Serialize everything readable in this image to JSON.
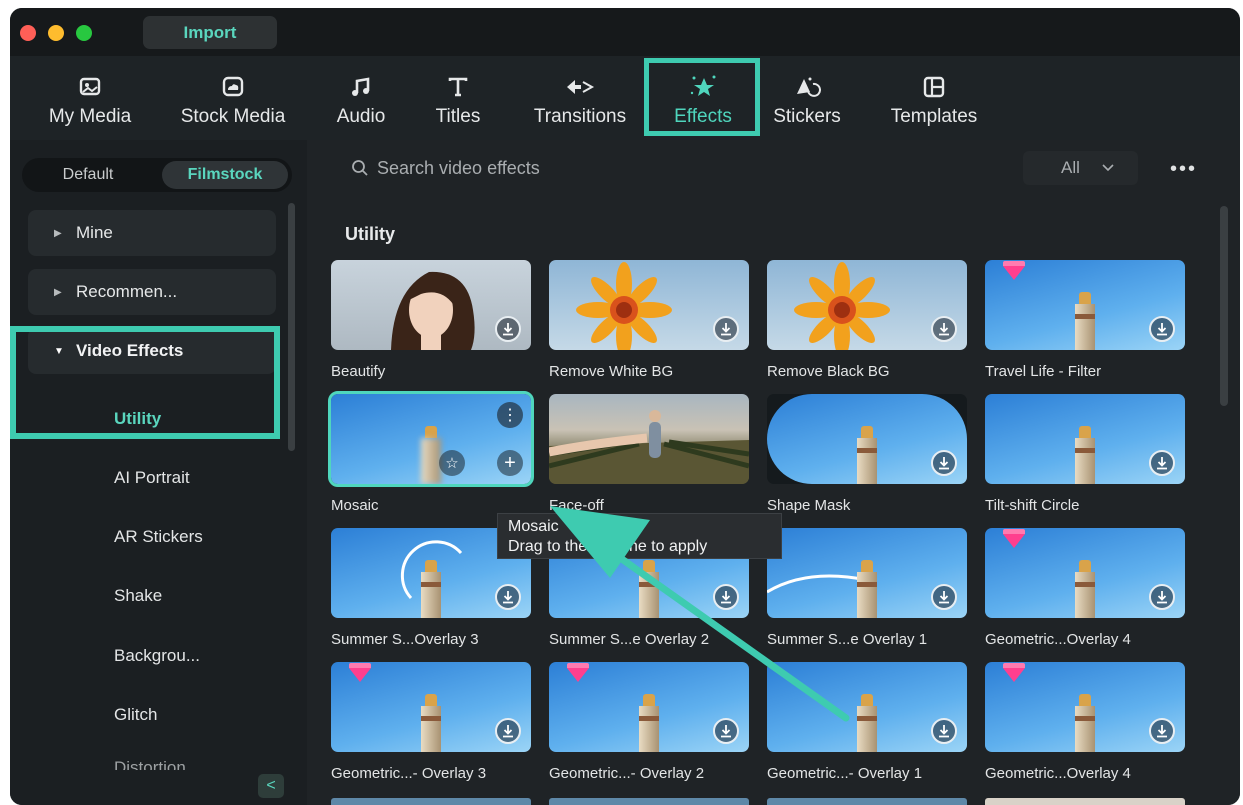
{
  "titlebar": {
    "import_label": "Import"
  },
  "toolbar": {
    "tabs": [
      {
        "label": "My Media",
        "icon": "media-icon"
      },
      {
        "label": "Stock Media",
        "icon": "cloud-image-icon"
      },
      {
        "label": "Audio",
        "icon": "music-note-icon"
      },
      {
        "label": "Titles",
        "icon": "text-t-icon"
      },
      {
        "label": "Transitions",
        "icon": "transition-arrows-icon"
      },
      {
        "label": "Effects",
        "icon": "star-sparkle-icon"
      },
      {
        "label": "Stickers",
        "icon": "sticker-icon"
      },
      {
        "label": "Templates",
        "icon": "layout-icon"
      }
    ],
    "active": "Effects"
  },
  "sidebar": {
    "segment": {
      "default_label": "Default",
      "filmstock_label": "Filmstock",
      "selected": "Filmstock"
    },
    "categories": {
      "mine": "Mine",
      "recommended": "Recommen...",
      "video_effects": "Video Effects"
    },
    "subitems": [
      "Utility",
      "AI Portrait",
      "AR Stickers",
      "Shake",
      "Backgrou...",
      "Glitch",
      "Distortion"
    ],
    "collapse_label": "<"
  },
  "search": {
    "placeholder": "Search video effects"
  },
  "filter": {
    "value": "All"
  },
  "more_label": "•••",
  "section_title": "Utility",
  "effects": [
    {
      "label": "Beautify"
    },
    {
      "label": "Remove White BG"
    },
    {
      "label": "Remove Black BG"
    },
    {
      "label": "Travel Life - Filter"
    },
    {
      "label": "Mosaic"
    },
    {
      "label": "Face-off"
    },
    {
      "label": "Shape Mask"
    },
    {
      "label": "Tilt-shift Circle"
    },
    {
      "label": "Summer S...Overlay 3"
    },
    {
      "label": "Summer S...e Overlay 2"
    },
    {
      "label": "Summer S...e Overlay 1"
    },
    {
      "label": "Geometric...Overlay 4"
    },
    {
      "label": "Geometric...- Overlay 3"
    },
    {
      "label": "Geometric...- Overlay 2"
    },
    {
      "label": "Geometric...- Overlay 1"
    },
    {
      "label": "Geometric...Overlay 4"
    }
  ],
  "tooltip": {
    "line1": "Mosaic",
    "line2": "Drag to the timeline to apply"
  },
  "colors": {
    "accent": "#3ecbb0",
    "background": "#151a1d",
    "panel": "#1b1f22"
  }
}
